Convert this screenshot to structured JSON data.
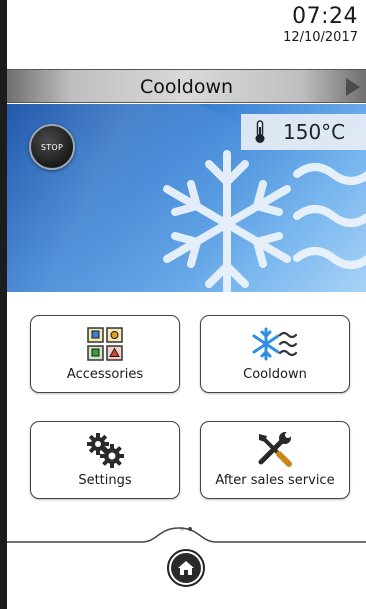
{
  "header": {
    "time": "07:24",
    "date": "12/10/2017"
  },
  "titlebar": {
    "title": "Cooldown",
    "next_icon": "play-arrow-icon"
  },
  "hero": {
    "stop_label": "STOP",
    "temperature": "150°C",
    "temperature_icon": "thermometer-icon",
    "art_icon": "snowflake-wind-icon"
  },
  "tiles": [
    {
      "label": "Accessories",
      "icon": "accessories-grid-icon"
    },
    {
      "label": "Cooldown",
      "icon": "snowflake-wind-icon"
    },
    {
      "label": "Settings",
      "icon": "gears-icon"
    },
    {
      "label": "After sales service",
      "icon": "tools-icon"
    }
  ],
  "pager": {
    "pages": 2,
    "current": 2
  },
  "colors": {
    "hero_dark": "#1f56a8",
    "hero_light": "#a8d3f7",
    "titlebar": "#d9d9d9"
  },
  "nav": {
    "home_icon": "home-icon"
  }
}
